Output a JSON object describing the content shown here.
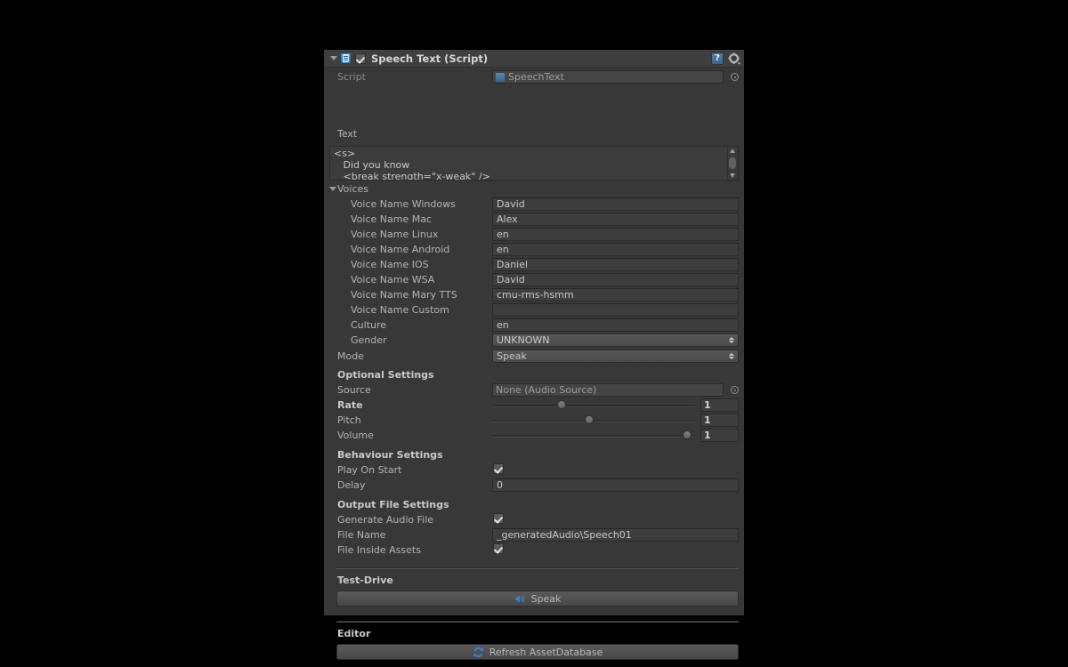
{
  "component": {
    "title": "Speech Text (Script)",
    "enabled_checkbox": true,
    "foldout_expanded": true,
    "icon": "script-icon",
    "help_icon": "help-book-icon",
    "gear_icon": "gear-icon"
  },
  "script_row": {
    "label": "Script",
    "value": "SpeechText",
    "picker_icon": "object-picker-icon"
  },
  "text_section": {
    "label": "Text",
    "value": "<s>\n   Did you know\n   <break strength=\"x-weak\" />",
    "scroll_up_icon": "scroll-up-arrow-icon",
    "scroll_down_icon": "scroll-down-arrow-icon"
  },
  "voices": {
    "header": "Voices",
    "expanded": true,
    "items": [
      {
        "label": "Voice Name Windows",
        "value": "David"
      },
      {
        "label": "Voice Name Mac",
        "value": "Alex"
      },
      {
        "label": "Voice Name Linux",
        "value": "en"
      },
      {
        "label": "Voice Name Android",
        "value": "en"
      },
      {
        "label": "Voice Name IOS",
        "value": "Daniel"
      },
      {
        "label": "Voice Name WSA",
        "value": "David"
      },
      {
        "label": "Voice Name Mary TTS",
        "value": "cmu-rms-hsmm"
      },
      {
        "label": "Voice Name Custom",
        "value": ""
      },
      {
        "label": "Culture",
        "value": "en"
      }
    ],
    "gender": {
      "label": "Gender",
      "value": "UNKNOWN"
    }
  },
  "mode": {
    "label": "Mode",
    "value": "Speak"
  },
  "optional_settings": {
    "header": "Optional Settings",
    "source": {
      "label": "Source",
      "value": "None (Audio Source)"
    },
    "sliders": [
      {
        "label": "Rate",
        "value": "1",
        "percent": 34,
        "bold": true
      },
      {
        "label": "Pitch",
        "value": "1",
        "percent": 48,
        "bold": false
      },
      {
        "label": "Volume",
        "value": "1",
        "percent": 96,
        "bold": false
      }
    ]
  },
  "behaviour_settings": {
    "header": "Behaviour Settings",
    "play_on_start": {
      "label": "Play On Start",
      "checked": true
    },
    "delay": {
      "label": "Delay",
      "value": "0"
    }
  },
  "output_file_settings": {
    "header": "Output File Settings",
    "generate_audio_file": {
      "label": "Generate Audio File",
      "checked": true
    },
    "file_name": {
      "label": "File Name",
      "value": "_generatedAudio\\Speech01"
    },
    "file_inside_assets": {
      "label": "File Inside Assets",
      "checked": true
    }
  },
  "test_drive": {
    "header": "Test-Drive",
    "button_label": "Speak",
    "button_icon": "speaker-icon"
  },
  "editor": {
    "header": "Editor",
    "button_label": "Refresh AssetDatabase",
    "button_icon": "refresh-icon"
  },
  "colors": {
    "panel_bg": "#383838",
    "header_bg": "#3f3f3f",
    "field_bg": "#3d3d3d",
    "accent_blue": "#3b7fd4",
    "text": "#b4b4b4"
  }
}
